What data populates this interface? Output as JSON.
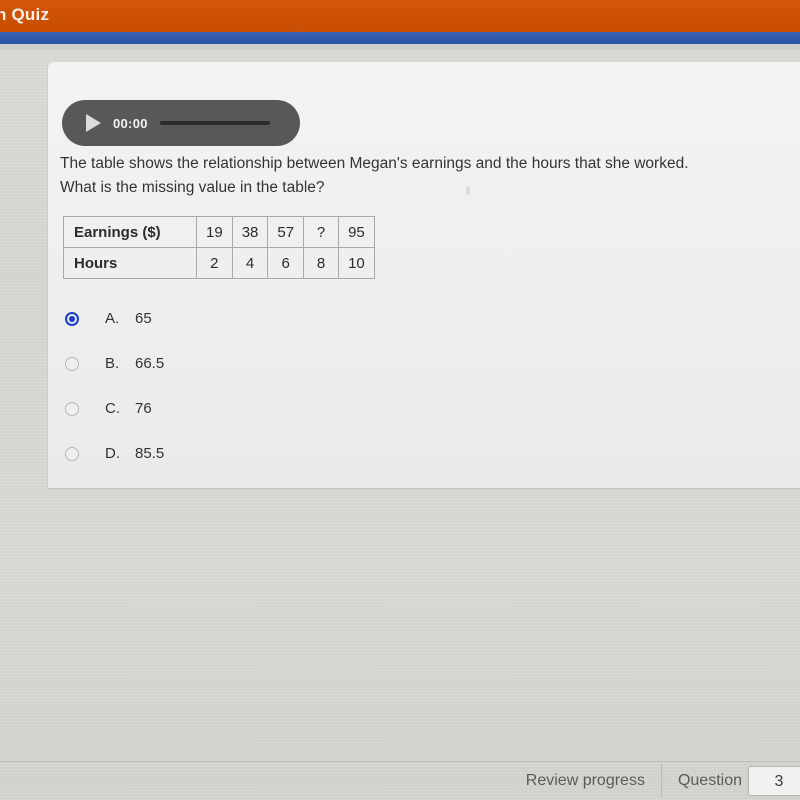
{
  "window": {
    "tab_title": "n Quiz",
    "orange_bar_color": "#cf5205",
    "blue_bar_color": "#2f59ad"
  },
  "audio_player": {
    "play_icon": "play-icon",
    "time": "00:00",
    "progress_percent": 0
  },
  "question": {
    "line1": "The table shows the relationship between Megan's earnings and the hours that she worked.",
    "line2": "What is the missing value in the table?"
  },
  "table": {
    "rows": [
      {
        "header": "Earnings ($)",
        "values": [
          "19",
          "38",
          "57",
          "?",
          "95"
        ]
      },
      {
        "header": "Hours",
        "values": [
          "2",
          "4",
          "6",
          "8",
          "10"
        ]
      }
    ]
  },
  "options": {
    "selected": "A",
    "accent_color": "#1a3fc4",
    "items": [
      {
        "letter": "A.",
        "value": "65",
        "selected": true
      },
      {
        "letter": "B.",
        "value": "66.5",
        "selected": false
      },
      {
        "letter": "C.",
        "value": "76",
        "selected": false
      },
      {
        "letter": "D.",
        "value": "85.5",
        "selected": false
      }
    ]
  },
  "footer": {
    "review_label": "Review progress",
    "question_label": "Question",
    "question_number": "3"
  }
}
